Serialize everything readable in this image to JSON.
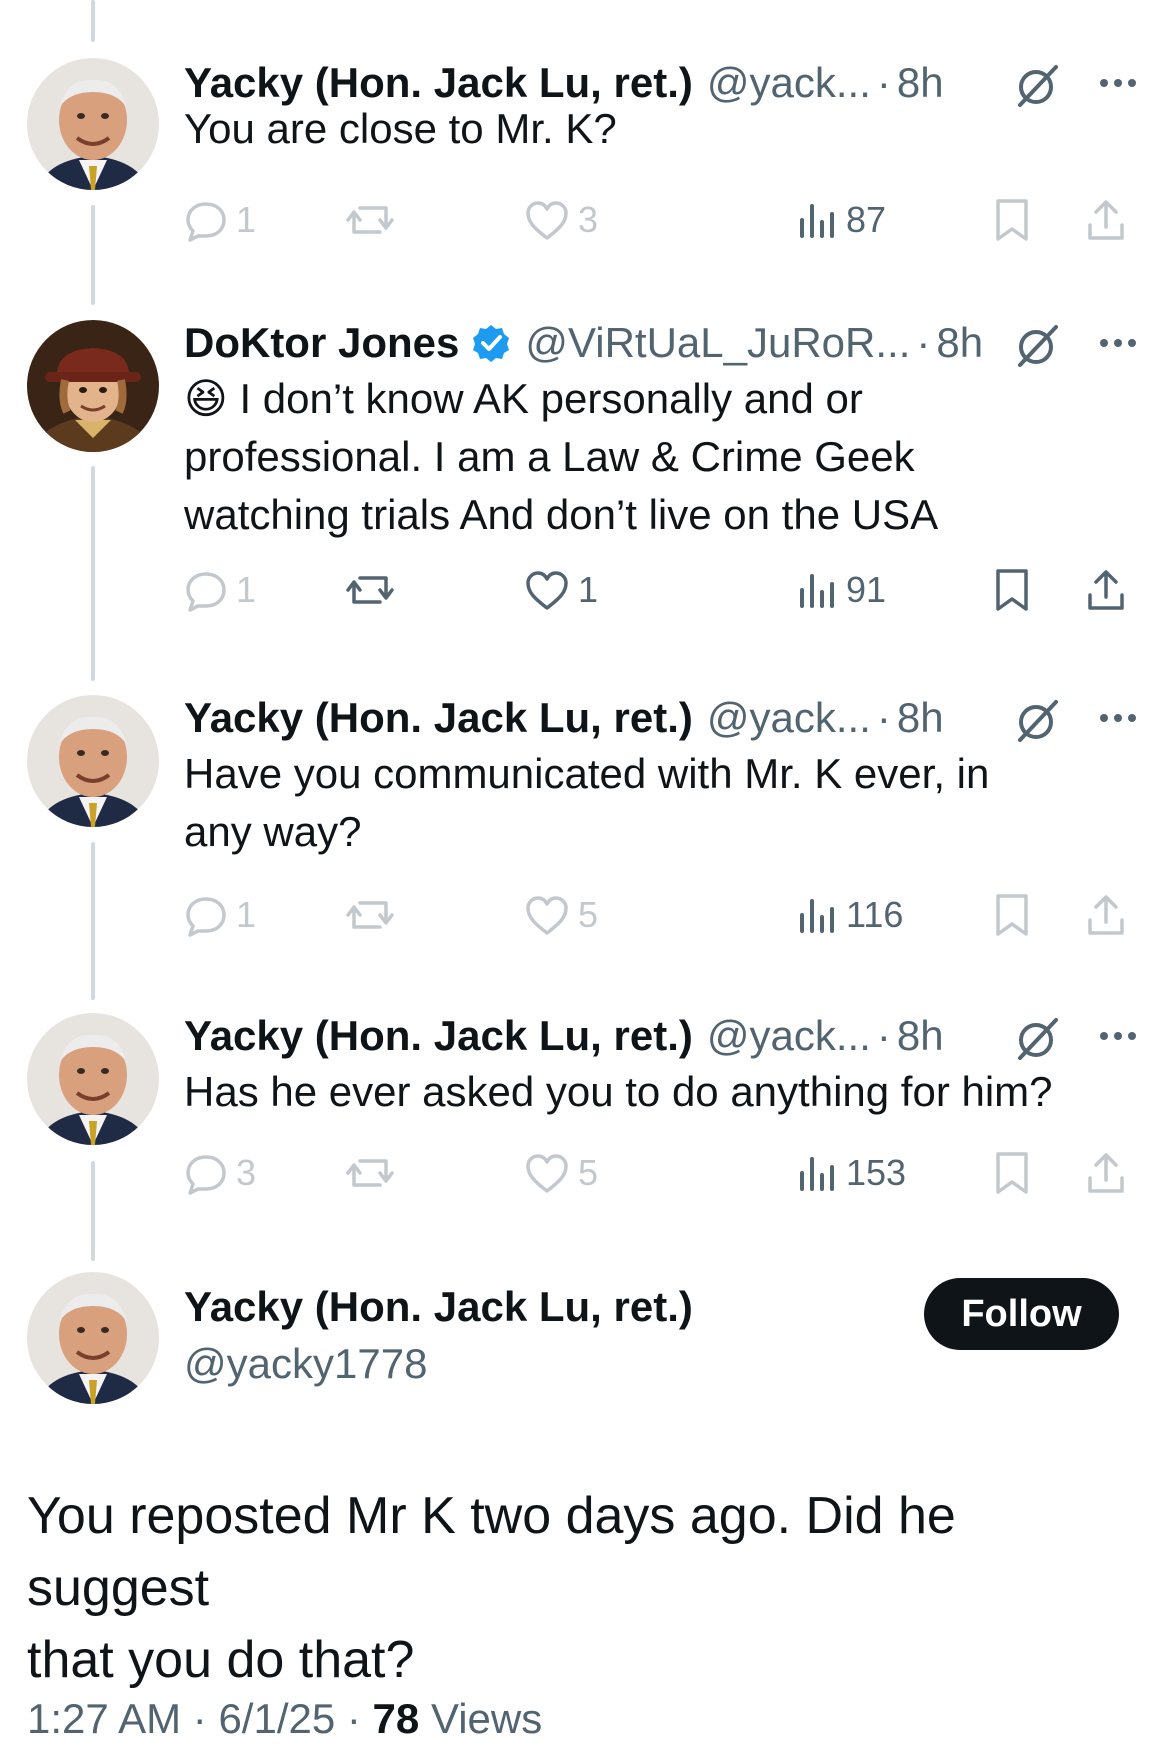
{
  "thread": [
    {
      "name": "Yacky (Hon. Jack Lu, ret.)",
      "handle": "@yack...",
      "time": "8h",
      "verified": false,
      "avatar": "avatar-yacky",
      "text_lines": [
        "You are close to Mr. K?"
      ],
      "replies": "1",
      "reposts": "",
      "likes": "3",
      "views": "87",
      "faint": true
    },
    {
      "name": "DoKtor Jones",
      "handle": "@ViRtUaL_JuRoR...",
      "time": "8h",
      "verified": true,
      "avatar": "avatar-doktor",
      "emoji": "😆",
      "text_lines": [
        "I don’t know AK personally and or",
        "professional. I am a Law & Crime Geek",
        "watching trials And don’t live on the USA"
      ],
      "replies": "1",
      "reposts": "",
      "likes": "1",
      "views": "91",
      "faint": false
    },
    {
      "name": "Yacky (Hon. Jack Lu, ret.)",
      "handle": "@yack...",
      "time": "8h",
      "verified": false,
      "avatar": "avatar-yacky",
      "text_lines": [
        "Have you communicated with Mr. K ever, in",
        "any way?"
      ],
      "replies": "1",
      "reposts": "",
      "likes": "5",
      "views": "116",
      "faint": true
    },
    {
      "name": "Yacky (Hon. Jack Lu, ret.)",
      "handle": "@yack...",
      "time": "8h",
      "verified": false,
      "avatar": "avatar-yacky",
      "text_lines": [
        "Has he ever asked you to do anything for him?"
      ],
      "replies": "3",
      "reposts": "",
      "likes": "5",
      "views": "153",
      "faint": true
    }
  ],
  "main": {
    "name": "Yacky (Hon. Jack Lu, ret.)",
    "handle": "@yacky1778",
    "follow_label": "Follow",
    "text_lines": [
      "You reposted Mr K two days ago. Did he suggest",
      "that you do that?"
    ],
    "time": "1:27 AM",
    "date": "6/1/25",
    "views_count": "78",
    "views_label": "Views"
  },
  "icons": {
    "reply": "reply-icon",
    "repost": "repost-icon",
    "like": "heart-icon",
    "views": "views-icon",
    "bookmark": "bookmark-icon",
    "share": "share-icon",
    "grok": "grok-icon",
    "more": "more-icon",
    "verified": "verified-badge-icon"
  },
  "colors": {
    "text": "#0f1419",
    "secondary": "#536471",
    "verified": "#1d9bf0",
    "thread_line": "#cfd9de",
    "follow_bg": "#0f1419"
  }
}
